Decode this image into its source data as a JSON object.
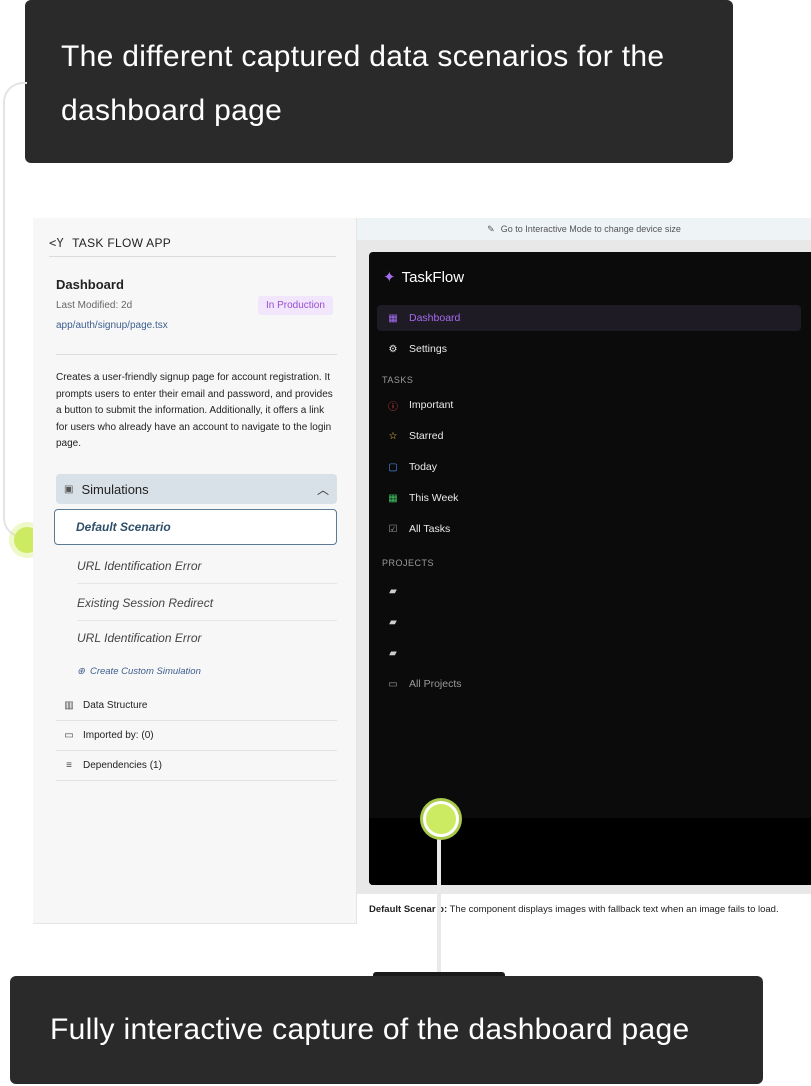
{
  "callouts": {
    "top": "The different captured data scenarios for the dashboard page",
    "bottom": "Fully interactive capture of the dashboard page"
  },
  "left_panel": {
    "app_name": "TASK FLOW APP",
    "page_title": "Dashboard",
    "last_modified": "Last Modified: 2d",
    "status_badge": "In Production",
    "file_path": "app/auth/signup/page.tsx",
    "description": "Creates a user-friendly signup page for account registration. It prompts users to enter their email and password, and provides a button to submit the information. Additionally, it offers a link for users who already have an account to navigate to the login page.",
    "simulations_label": "Simulations",
    "scenarios": [
      "Default Scenario",
      "URL Identification Error",
      "Existing Session Redirect",
      "URL Identification Error"
    ],
    "create_custom": "Create Custom Simulation",
    "meta": [
      {
        "icon": "database-icon",
        "label": "Data Structure"
      },
      {
        "icon": "monitor-icon",
        "label": "Imported by: (0)"
      },
      {
        "icon": "list-icon",
        "label": "Dependencies (1)"
      }
    ]
  },
  "preview": {
    "hint": "Go to Interactive Mode to change device size",
    "brand": "TaskFlow",
    "nav_main": [
      {
        "icon": "grid-icon",
        "label": "Dashboard",
        "active": true
      },
      {
        "icon": "gear-icon",
        "label": "Settings"
      }
    ],
    "tasks_header": "TASKS",
    "tasks": [
      {
        "icon": "alert-circle-icon",
        "label": "Important",
        "color": "#e5484d"
      },
      {
        "icon": "star-icon",
        "label": "Starred",
        "color": "#f5c542"
      },
      {
        "icon": "calendar-icon",
        "label": "Today",
        "color": "#4f8ff7"
      },
      {
        "icon": "calendar-week-icon",
        "label": "This Week",
        "color": "#3fbf5f"
      },
      {
        "icon": "checkbox-icon",
        "label": "All Tasks",
        "color": "#9a9a9a"
      }
    ],
    "projects_header": "PROJECTS",
    "all_projects": "All Projects",
    "caption_bold": "Default Scenar o:",
    "caption_rest": " The component displays images with fallback text when an image fails to load."
  },
  "colors": {
    "accent": "#a56bf0",
    "callout_bg": "#2a2a2a",
    "highlight_dot": "#cdea63"
  }
}
